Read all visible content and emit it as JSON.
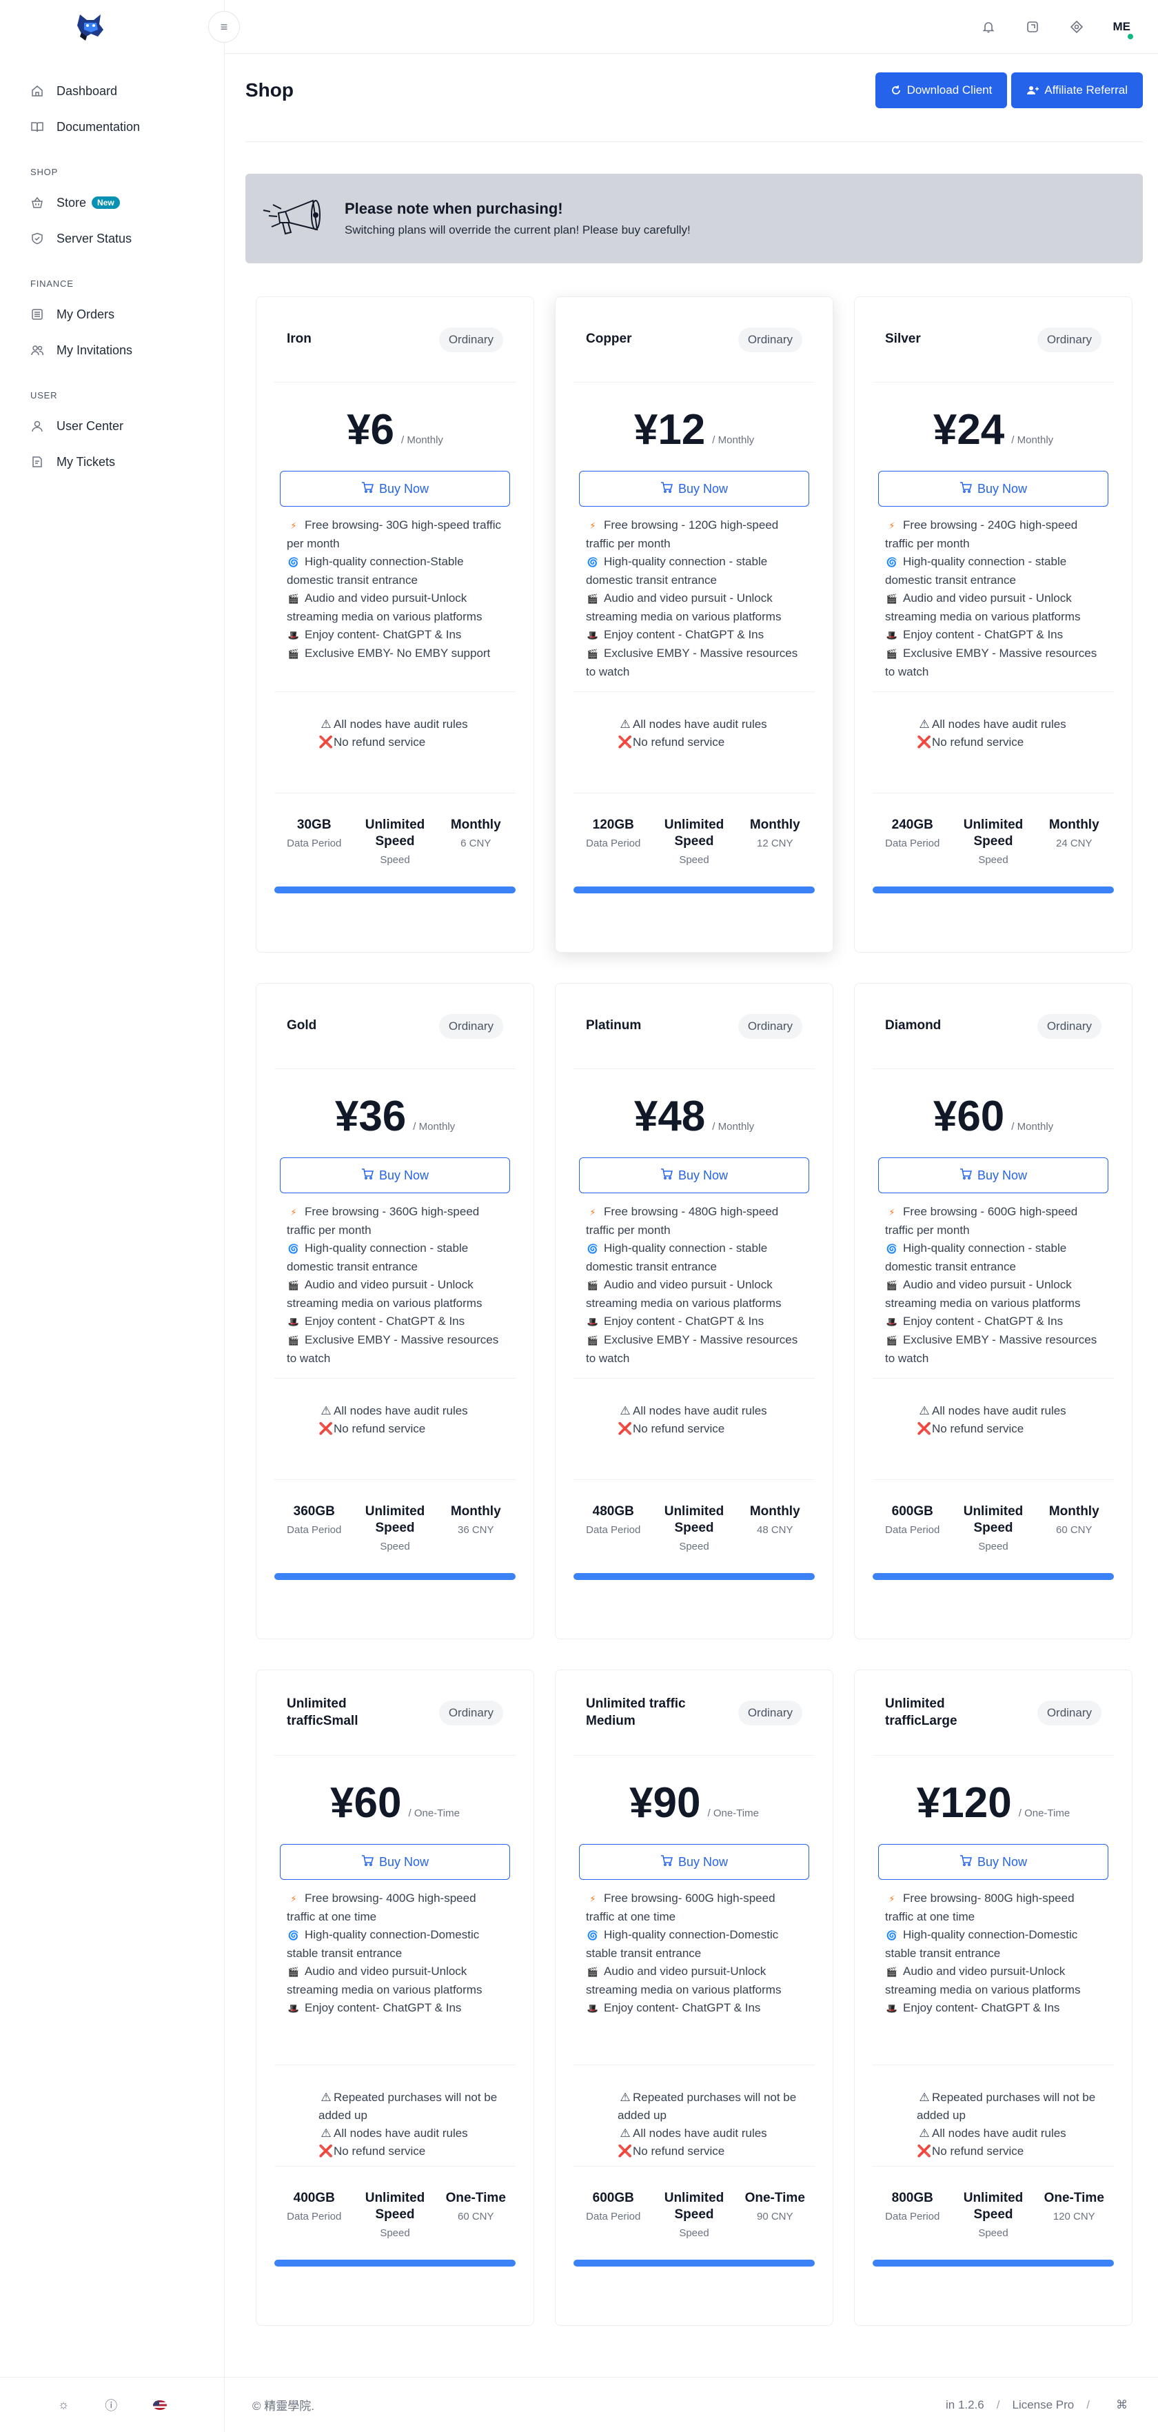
{
  "sidebar": {
    "sections": [
      {
        "title": "",
        "items": [
          {
            "label": "Dashboard",
            "icon": "home-icon"
          },
          {
            "label": "Documentation",
            "icon": "book-icon"
          }
        ]
      },
      {
        "title": "SHOP",
        "items": [
          {
            "label": "Store",
            "icon": "basket-icon",
            "badge": "New"
          },
          {
            "label": "Server Status",
            "icon": "shield-icon"
          }
        ]
      },
      {
        "title": "FINANCE",
        "items": [
          {
            "label": "My Orders",
            "icon": "list-icon"
          },
          {
            "label": "My Invitations",
            "icon": "users-icon"
          }
        ]
      },
      {
        "title": "USER",
        "items": [
          {
            "label": "User Center",
            "icon": "user-icon"
          },
          {
            "label": "My Tickets",
            "icon": "ticket-icon"
          }
        ]
      }
    ],
    "footer_icons": [
      "sun-icon",
      "info-icon",
      "us-flag-icon"
    ]
  },
  "topbar": {
    "icons": [
      "bell-icon",
      "refresh-icon",
      "settings-icon"
    ],
    "avatar": "ME",
    "status_color": "#10b981"
  },
  "page": {
    "title": "Shop",
    "actions": [
      "Download Client",
      "Affiliate Referral"
    ]
  },
  "notice": {
    "title": "Please note when purchasing!",
    "text": "Switching plans will override the current plan! Please buy carefully!"
  },
  "plans": [
    {
      "name": "Iron",
      "tag": "Ordinary",
      "price": "¥6",
      "period": "/ Monthly",
      "buy": "Buy Now",
      "features": [
        {
          "icon": "⚡",
          "text": "Free browsing- 30G high-speed traffic per month"
        },
        {
          "icon": "🌀",
          "text": "High-quality connection-Stable domestic transit entrance"
        },
        {
          "icon": "🎬",
          "text": "Audio and video pursuit-Unlock streaming media on various platforms"
        },
        {
          "icon": "🎩",
          "text": "Enjoy content- ChatGPT & Ins"
        },
        {
          "icon": "🎬",
          "text": "Exclusive EMBY- No EMBY support"
        }
      ],
      "warnings": [
        {
          "icon": "⚠",
          "text": "All nodes have audit rules"
        },
        {
          "icon": "❌",
          "text": "No refund service"
        }
      ],
      "stats": [
        {
          "value": "30GB",
          "label": "Data Period"
        },
        {
          "value": "Unlimited Speed",
          "label": "Speed"
        },
        {
          "value": "Monthly",
          "label": "6 CNY"
        }
      ]
    },
    {
      "name": "Copper",
      "tag": "Ordinary",
      "price": "¥12",
      "period": "/ Monthly",
      "buy": "Buy Now",
      "features": [
        {
          "icon": "⚡",
          "text": "Free browsing - 120G high-speed traffic per month"
        },
        {
          "icon": "🌀",
          "text": "High-quality connection - stable domestic transit entrance"
        },
        {
          "icon": "🎬",
          "text": "Audio and video pursuit - Unlock streaming media on various platforms"
        },
        {
          "icon": "🎩",
          "text": "Enjoy content - ChatGPT & Ins"
        },
        {
          "icon": "🎬",
          "text": "Exclusive EMBY - Massive resources to watch"
        }
      ],
      "warnings": [
        {
          "icon": "⚠",
          "text": "All nodes have audit rules"
        },
        {
          "icon": "❌",
          "text": "No refund service"
        }
      ],
      "stats": [
        {
          "value": "120GB",
          "label": "Data Period"
        },
        {
          "value": "Unlimited Speed",
          "label": "Speed"
        },
        {
          "value": "Monthly",
          "label": "12 CNY"
        }
      ]
    },
    {
      "name": "Silver",
      "tag": "Ordinary",
      "price": "¥24",
      "period": "/ Monthly",
      "buy": "Buy Now",
      "features": [
        {
          "icon": "⚡",
          "text": "Free browsing - 240G high-speed traffic per month"
        },
        {
          "icon": "🌀",
          "text": "High-quality connection - stable domestic transit entrance"
        },
        {
          "icon": "🎬",
          "text": "Audio and video pursuit - Unlock streaming media on various platforms"
        },
        {
          "icon": "🎩",
          "text": "Enjoy content - ChatGPT & Ins"
        },
        {
          "icon": "🎬",
          "text": "Exclusive EMBY - Massive resources to watch"
        }
      ],
      "warnings": [
        {
          "icon": "⚠",
          "text": "All nodes have audit rules"
        },
        {
          "icon": "❌",
          "text": "No refund service"
        }
      ],
      "stats": [
        {
          "value": "240GB",
          "label": "Data Period"
        },
        {
          "value": "Unlimited Speed",
          "label": "Speed"
        },
        {
          "value": "Monthly",
          "label": "24 CNY"
        }
      ]
    },
    {
      "name": "Gold",
      "tag": "Ordinary",
      "price": "¥36",
      "period": "/ Monthly",
      "buy": "Buy Now",
      "features": [
        {
          "icon": "⚡",
          "text": "Free browsing - 360G high-speed traffic per month"
        },
        {
          "icon": "🌀",
          "text": "High-quality connection - stable domestic transit entrance"
        },
        {
          "icon": "🎬",
          "text": "Audio and video pursuit - Unlock streaming media on various platforms"
        },
        {
          "icon": "🎩",
          "text": "Enjoy content - ChatGPT & Ins"
        },
        {
          "icon": "🎬",
          "text": "Exclusive EMBY - Massive resources to watch"
        }
      ],
      "warnings": [
        {
          "icon": "⚠",
          "text": "All nodes have audit rules"
        },
        {
          "icon": "❌",
          "text": "No refund service"
        }
      ],
      "stats": [
        {
          "value": "360GB",
          "label": "Data Period"
        },
        {
          "value": "Unlimited Speed",
          "label": "Speed"
        },
        {
          "value": "Monthly",
          "label": "36 CNY"
        }
      ]
    },
    {
      "name": "Platinum",
      "tag": "Ordinary",
      "price": "¥48",
      "period": "/ Monthly",
      "buy": "Buy Now",
      "features": [
        {
          "icon": "⚡",
          "text": "Free browsing - 480G high-speed traffic per month"
        },
        {
          "icon": "🌀",
          "text": "High-quality connection - stable domestic transit entrance"
        },
        {
          "icon": "🎬",
          "text": "Audio and video pursuit - Unlock streaming media on various platforms"
        },
        {
          "icon": "🎩",
          "text": "Enjoy content - ChatGPT & Ins"
        },
        {
          "icon": "🎬",
          "text": "Exclusive EMBY - Massive resources to watch"
        }
      ],
      "warnings": [
        {
          "icon": "⚠",
          "text": "All nodes have audit rules"
        },
        {
          "icon": "❌",
          "text": "No refund service"
        }
      ],
      "stats": [
        {
          "value": "480GB",
          "label": "Data Period"
        },
        {
          "value": "Unlimited Speed",
          "label": "Speed"
        },
        {
          "value": "Monthly",
          "label": "48 CNY"
        }
      ]
    },
    {
      "name": "Diamond",
      "tag": "Ordinary",
      "price": "¥60",
      "period": "/ Monthly",
      "buy": "Buy Now",
      "features": [
        {
          "icon": "⚡",
          "text": "Free browsing - 600G high-speed traffic per month"
        },
        {
          "icon": "🌀",
          "text": "High-quality connection - stable domestic transit entrance"
        },
        {
          "icon": "🎬",
          "text": "Audio and video pursuit - Unlock streaming media on various platforms"
        },
        {
          "icon": "🎩",
          "text": "Enjoy content - ChatGPT & Ins"
        },
        {
          "icon": "🎬",
          "text": "Exclusive EMBY - Massive resources to watch"
        }
      ],
      "warnings": [
        {
          "icon": "⚠",
          "text": "All nodes have audit rules"
        },
        {
          "icon": "❌",
          "text": "No refund service"
        }
      ],
      "stats": [
        {
          "value": "600GB",
          "label": "Data Period"
        },
        {
          "value": "Unlimited Speed",
          "label": "Speed"
        },
        {
          "value": "Monthly",
          "label": "60 CNY"
        }
      ]
    },
    {
      "name": "Unlimited trafficSmall",
      "tag": "Ordinary",
      "price": "¥60",
      "period": "/ One-Time",
      "buy": "Buy Now",
      "features": [
        {
          "icon": "⚡",
          "text": "Free browsing- 400G high-speed traffic at one time"
        },
        {
          "icon": "🌀",
          "text": "High-quality connection-Domestic stable transit entrance"
        },
        {
          "icon": "🎬",
          "text": "Audio and video pursuit-Unlock streaming media on various platforms"
        },
        {
          "icon": "🎩",
          "text": "Enjoy content- ChatGPT & Ins"
        }
      ],
      "warnings": [
        {
          "icon": "⚠",
          "text": "Repeated purchases will not be added up"
        },
        {
          "icon": "⚠",
          "text": "All nodes have audit rules"
        },
        {
          "icon": "❌",
          "text": "No refund service"
        }
      ],
      "stats": [
        {
          "value": "400GB",
          "label": "Data Period"
        },
        {
          "value": "Unlimited Speed",
          "label": "Speed"
        },
        {
          "value": "One-Time",
          "label": "60 CNY"
        }
      ]
    },
    {
      "name": "Unlimited traffic Medium",
      "tag": "Ordinary",
      "price": "¥90",
      "period": "/ One-Time",
      "buy": "Buy Now",
      "features": [
        {
          "icon": "⚡",
          "text": "Free browsing- 600G high-speed traffic at one time"
        },
        {
          "icon": "🌀",
          "text": "High-quality connection-Domestic stable transit entrance"
        },
        {
          "icon": "🎬",
          "text": "Audio and video pursuit-Unlock streaming media on various platforms"
        },
        {
          "icon": "🎩",
          "text": "Enjoy content- ChatGPT & Ins"
        }
      ],
      "warnings": [
        {
          "icon": "⚠",
          "text": "Repeated purchases will not be added up"
        },
        {
          "icon": "⚠",
          "text": "All nodes have audit rules"
        },
        {
          "icon": "❌",
          "text": "No refund service"
        }
      ],
      "stats": [
        {
          "value": "600GB",
          "label": "Data Period"
        },
        {
          "value": "Unlimited Speed",
          "label": "Speed"
        },
        {
          "value": "One-Time",
          "label": "90 CNY"
        }
      ]
    },
    {
      "name": "Unlimited trafficLarge",
      "tag": "Ordinary",
      "price": "¥120",
      "period": "/ One-Time",
      "buy": "Buy Now",
      "features": [
        {
          "icon": "⚡",
          "text": "Free browsing- 800G high-speed traffic at one time"
        },
        {
          "icon": "🌀",
          "text": "High-quality connection-Domestic stable transit entrance"
        },
        {
          "icon": "🎬",
          "text": "Audio and video pursuit-Unlock streaming media on various platforms"
        },
        {
          "icon": "🎩",
          "text": "Enjoy content- ChatGPT & Ins"
        }
      ],
      "warnings": [
        {
          "icon": "⚠",
          "text": "Repeated purchases will not be added up"
        },
        {
          "icon": "⚠",
          "text": "All nodes have audit rules"
        },
        {
          "icon": "❌",
          "text": "No refund service"
        }
      ],
      "stats": [
        {
          "value": "800GB",
          "label": "Data Period"
        },
        {
          "value": "Unlimited Speed",
          "label": "Speed"
        },
        {
          "value": "One-Time",
          "label": "120 CNY"
        }
      ]
    }
  ],
  "footer": {
    "copyright": "© 精靈學院.",
    "version": "in 1.2.6",
    "license": "License Pro",
    "shortcut": "⌘"
  },
  "colors": {
    "accent": "#2563eb",
    "bar": "#3b82f6",
    "notice_bg": "#d1d5db",
    "badge": "#0891b2"
  }
}
